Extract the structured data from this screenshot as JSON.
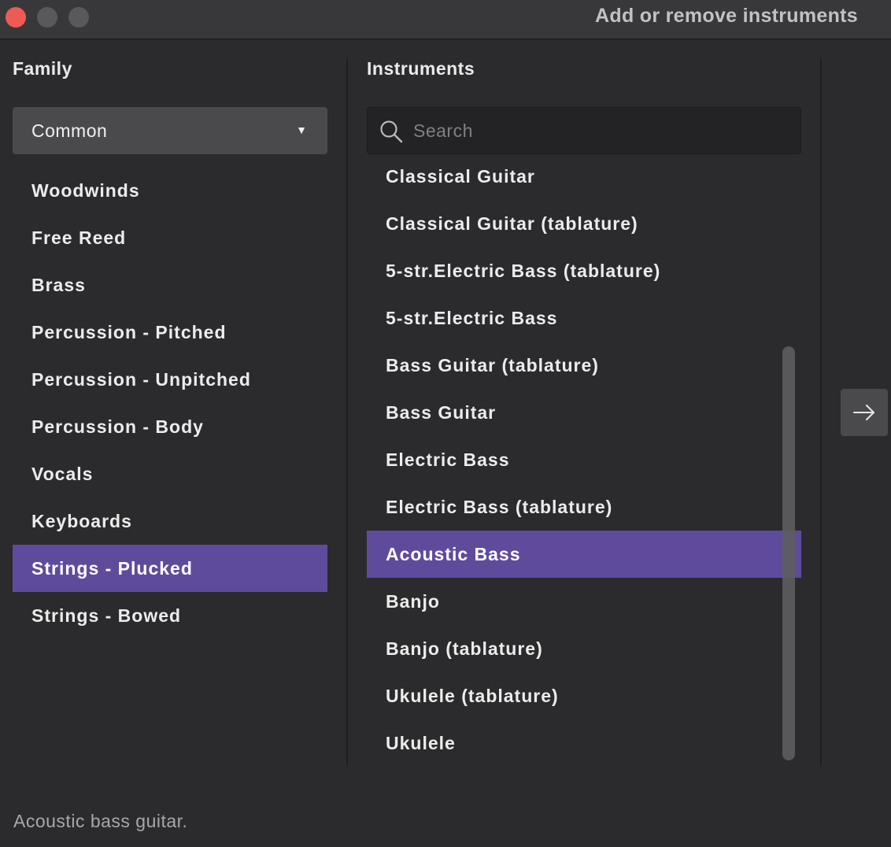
{
  "window": {
    "title": "Add or remove instruments"
  },
  "family": {
    "header": "Family",
    "dropdown_value": "Common",
    "items": [
      {
        "label": "Woodwinds"
      },
      {
        "label": "Free Reed"
      },
      {
        "label": "Brass"
      },
      {
        "label": "Percussion - Pitched"
      },
      {
        "label": "Percussion - Unpitched"
      },
      {
        "label": "Percussion - Body"
      },
      {
        "label": "Vocals"
      },
      {
        "label": "Keyboards"
      },
      {
        "label": "Strings - Plucked",
        "selected": true
      },
      {
        "label": "Strings - Bowed"
      }
    ]
  },
  "instruments": {
    "header": "Instruments",
    "search_placeholder": "Search",
    "items": [
      {
        "label": "Classical Guitar"
      },
      {
        "label": "Classical Guitar (tablature)"
      },
      {
        "label": "5-str.Electric Bass (tablature)"
      },
      {
        "label": "5-str.Electric Bass"
      },
      {
        "label": "Bass Guitar (tablature)"
      },
      {
        "label": "Bass Guitar"
      },
      {
        "label": "Electric Bass"
      },
      {
        "label": "Electric Bass (tablature)"
      },
      {
        "label": "Acoustic Bass",
        "selected": true
      },
      {
        "label": "Banjo"
      },
      {
        "label": "Banjo (tablature)"
      },
      {
        "label": "Ukulele (tablature)"
      },
      {
        "label": "Ukulele"
      }
    ]
  },
  "description": "Acoustic bass guitar.",
  "icons": {
    "search": "search-icon",
    "dropdown": "triangle-down-icon",
    "add": "arrow-right-icon"
  },
  "colors": {
    "accent": "#5f4b9b",
    "close": "#ee5b55",
    "background": "#2b2b2d"
  }
}
